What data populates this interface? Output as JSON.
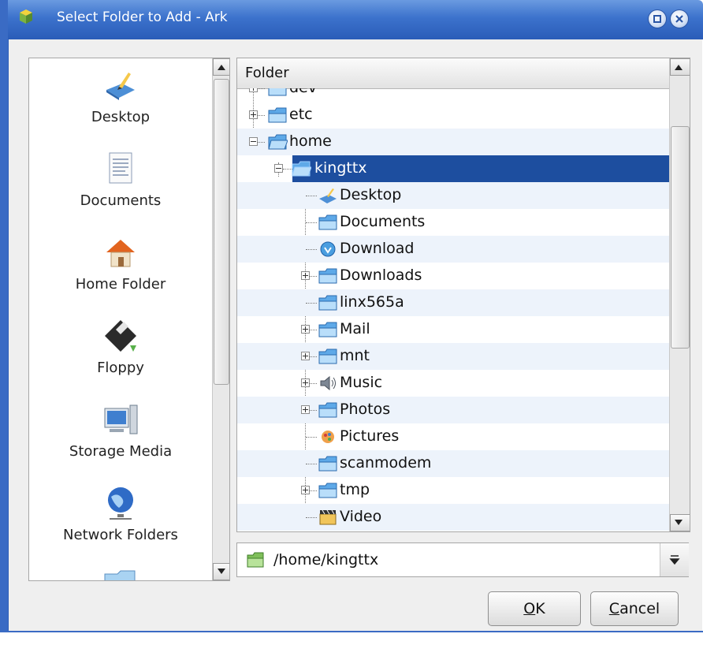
{
  "window": {
    "title": "Select Folder to Add - Ark"
  },
  "places": [
    {
      "label": "Desktop",
      "icon": "desktop-icon"
    },
    {
      "label": "Documents",
      "icon": "documents-icon"
    },
    {
      "label": "Home Folder",
      "icon": "home-folder-icon"
    },
    {
      "label": "Floppy",
      "icon": "floppy-icon"
    },
    {
      "label": "Storage Media",
      "icon": "storage-media-icon"
    },
    {
      "label": "Network Folders",
      "icon": "network-folders-icon"
    }
  ],
  "tree": {
    "header": "Folder",
    "rows": [
      {
        "label": "dev",
        "icon": "folder-icon"
      },
      {
        "label": "etc",
        "icon": "folder-icon"
      },
      {
        "label": "home",
        "icon": "folder-icon"
      },
      {
        "label": "kingttx",
        "icon": "folder-icon"
      },
      {
        "label": "Desktop",
        "icon": "desktop-icon"
      },
      {
        "label": "Documents",
        "icon": "folder-icon"
      },
      {
        "label": "Download",
        "icon": "download-icon"
      },
      {
        "label": "Downloads",
        "icon": "folder-icon"
      },
      {
        "label": "linx565a",
        "icon": "folder-icon"
      },
      {
        "label": "Mail",
        "icon": "folder-icon"
      },
      {
        "label": "mnt",
        "icon": "folder-icon"
      },
      {
        "label": "Music",
        "icon": "music-icon"
      },
      {
        "label": "Photos",
        "icon": "folder-icon"
      },
      {
        "label": "Pictures",
        "icon": "pictures-icon"
      },
      {
        "label": "scanmodem",
        "icon": "folder-icon"
      },
      {
        "label": "tmp",
        "icon": "folder-icon"
      },
      {
        "label": "Video",
        "icon": "video-icon"
      }
    ]
  },
  "path": {
    "value": "/home/kingttx",
    "icon": "folder-icon"
  },
  "buttons": {
    "ok_mnemonic": "O",
    "ok_rest": "K",
    "cancel_mnemonic": "C",
    "cancel_rest": "ancel"
  },
  "colors": {
    "titlebar": "#3c72cc",
    "selection": "#1d4e9f",
    "alt_row": "#edf3fb"
  }
}
